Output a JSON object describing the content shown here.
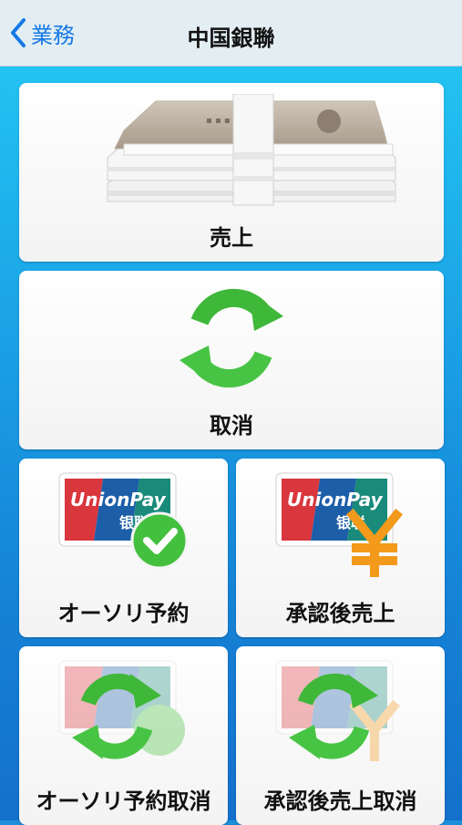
{
  "nav": {
    "back_label": "業務",
    "title": "中国銀聯"
  },
  "tiles": {
    "sale": "売上",
    "cancel": "取消",
    "auth": "オーソリ予約",
    "post_auth_sale": "承認後売上",
    "auth_cancel": "オーソリ予約取消",
    "post_auth_sale_cancel": "承認後売上取消"
  },
  "card": {
    "brand_text": "UnionPay",
    "brand_cjk": "银联"
  },
  "icons": {
    "back": "chevron-left-icon",
    "sale": "banknotes-icon",
    "cancel": "refresh-arrows-icon",
    "auth": "unionpay-card-check-icon",
    "post_auth_sale": "unionpay-card-yen-icon",
    "auth_cancel": "unionpay-card-check-refresh-icon",
    "post_auth_sale_cancel": "unionpay-card-yen-refresh-icon"
  },
  "colors": {
    "accent": "#1578e6",
    "green": "#3fb83a",
    "yen_orange": "#f39a1b"
  }
}
